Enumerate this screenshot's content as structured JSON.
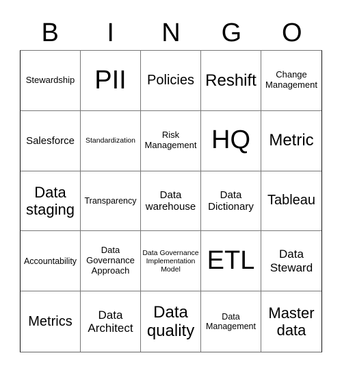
{
  "header": {
    "letters": [
      "B",
      "I",
      "N",
      "G",
      "O"
    ]
  },
  "grid": {
    "rows": [
      [
        "Stewardship",
        "PII",
        "Policies",
        "Reshift",
        "Change Management"
      ],
      [
        "Salesforce",
        "Standardization",
        "Risk Management",
        "HQ",
        "Metric"
      ],
      [
        "Data staging",
        "Transparency",
        "Data warehouse",
        "Data Dictionary",
        "Tableau"
      ],
      [
        "Accountability",
        "Data Governance Approach",
        "Data Governance Implementation Model",
        "ETL",
        "Data Steward"
      ],
      [
        "Metrics",
        "Data Architect",
        "Data quality",
        "Data Management",
        "Master data"
      ]
    ]
  }
}
